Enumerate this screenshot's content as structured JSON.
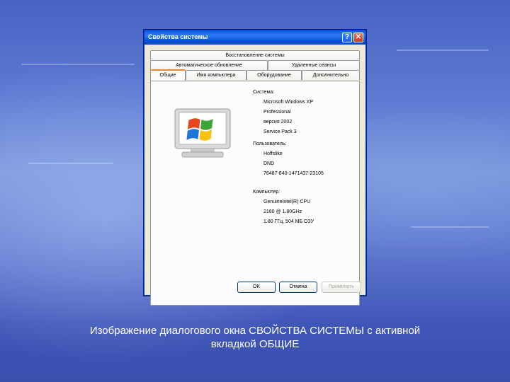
{
  "window": {
    "title": "Свойства системы",
    "help_symbol": "?",
    "close_symbol": "✕"
  },
  "tabs": {
    "row1": [
      "Восстановление системы"
    ],
    "row2": [
      "Автоматическое обновление",
      "Удаленные сеансы"
    ],
    "row3": [
      "Общие",
      "Имя компьютера",
      "Оборудование",
      "Дополнительно"
    ],
    "active": "Общие"
  },
  "general": {
    "system_header": "Система:",
    "system": [
      "Microsoft Windows XP",
      "Professional",
      "версия 2002",
      "Service Pack 3"
    ],
    "user_header": "Пользователь:",
    "user": [
      "Hoffslike",
      "DND",
      "76487-640-1471437-23105"
    ],
    "computer_header": "Компьютер:",
    "computer": [
      "GenuineIntel(R) CPU",
      "2160 @ 1.80GHz",
      "1.80 ГГц, 504 МБ ОЗУ"
    ]
  },
  "buttons": {
    "ok": "OK",
    "cancel": "Отмена",
    "apply": "Применить"
  },
  "caption": {
    "line1": "Изображение диалогового окна СВОЙСТВА СИСТЕМЫ с активной",
    "line2": "вкладкой ОБЩИЕ"
  }
}
